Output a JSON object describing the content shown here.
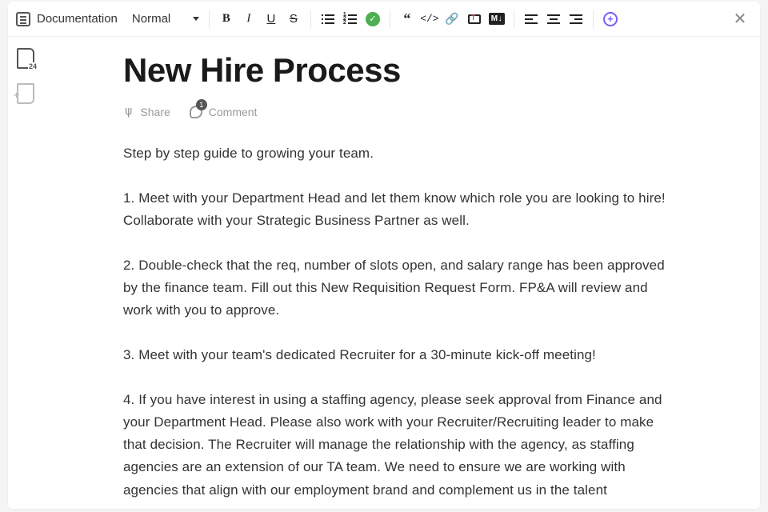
{
  "toolbar": {
    "doc_type": "Documentation",
    "text_style": "Normal",
    "comment_count": "1",
    "page_badge": "24"
  },
  "document": {
    "title": "New Hire Process",
    "actions": {
      "share": "Share",
      "comment": "Comment"
    },
    "intro": "Step by step guide to growing your team.",
    "steps": [
      "1. Meet with your Department Head and let them know which role you are looking to hire!  Collaborate with your Strategic Business Partner as well.",
      "2. Double-check that the req, number of slots open, and salary range has been approved by the finance team.  Fill out this New Requisition Request Form.  FP&A will review and work with you to approve.",
      "3. Meet with your team's dedicated Recruiter for a 30-minute kick-off meeting!",
      "4. If you have interest in using a staffing agency, please seek approval from Finance and your Department Head.  Please also work with your Recruiter/Recruiting leader to make that decision.  The Recruiter will manage the relationship with the agency, as staffing agencies are an extension of our TA team.  We need to ensure we are working with agencies that align with our employment brand and complement us in the talent"
    ]
  }
}
